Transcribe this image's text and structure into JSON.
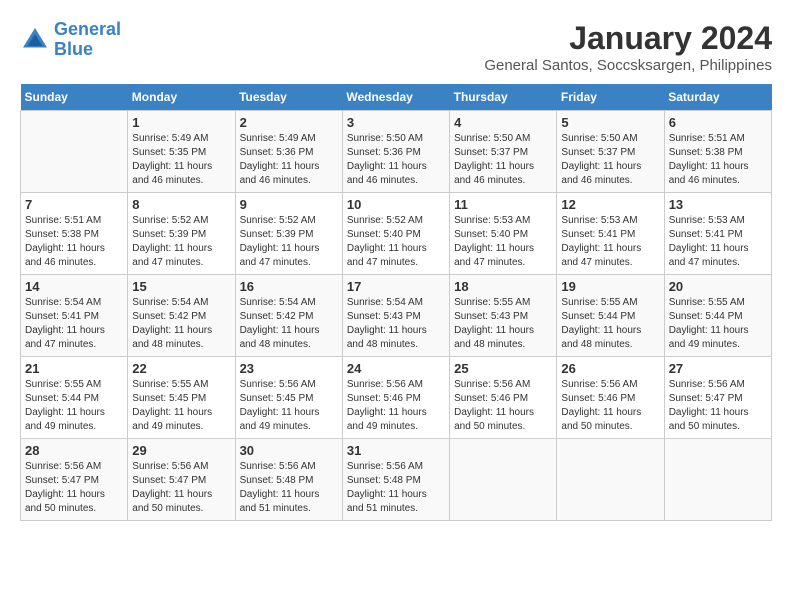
{
  "header": {
    "logo_line1": "General",
    "logo_line2": "Blue",
    "month_year": "January 2024",
    "location": "General Santos, Soccsksargen, Philippines"
  },
  "days_of_week": [
    "Sunday",
    "Monday",
    "Tuesday",
    "Wednesday",
    "Thursday",
    "Friday",
    "Saturday"
  ],
  "weeks": [
    [
      {
        "day": "",
        "info": ""
      },
      {
        "day": "1",
        "info": "Sunrise: 5:49 AM\nSunset: 5:35 PM\nDaylight: 11 hours and 46 minutes."
      },
      {
        "day": "2",
        "info": "Sunrise: 5:49 AM\nSunset: 5:36 PM\nDaylight: 11 hours and 46 minutes."
      },
      {
        "day": "3",
        "info": "Sunrise: 5:50 AM\nSunset: 5:36 PM\nDaylight: 11 hours and 46 minutes."
      },
      {
        "day": "4",
        "info": "Sunrise: 5:50 AM\nSunset: 5:37 PM\nDaylight: 11 hours and 46 minutes."
      },
      {
        "day": "5",
        "info": "Sunrise: 5:50 AM\nSunset: 5:37 PM\nDaylight: 11 hours and 46 minutes."
      },
      {
        "day": "6",
        "info": "Sunrise: 5:51 AM\nSunset: 5:38 PM\nDaylight: 11 hours and 46 minutes."
      }
    ],
    [
      {
        "day": "7",
        "info": "Sunrise: 5:51 AM\nSunset: 5:38 PM\nDaylight: 11 hours and 46 minutes."
      },
      {
        "day": "8",
        "info": "Sunrise: 5:52 AM\nSunset: 5:39 PM\nDaylight: 11 hours and 47 minutes."
      },
      {
        "day": "9",
        "info": "Sunrise: 5:52 AM\nSunset: 5:39 PM\nDaylight: 11 hours and 47 minutes."
      },
      {
        "day": "10",
        "info": "Sunrise: 5:52 AM\nSunset: 5:40 PM\nDaylight: 11 hours and 47 minutes."
      },
      {
        "day": "11",
        "info": "Sunrise: 5:53 AM\nSunset: 5:40 PM\nDaylight: 11 hours and 47 minutes."
      },
      {
        "day": "12",
        "info": "Sunrise: 5:53 AM\nSunset: 5:41 PM\nDaylight: 11 hours and 47 minutes."
      },
      {
        "day": "13",
        "info": "Sunrise: 5:53 AM\nSunset: 5:41 PM\nDaylight: 11 hours and 47 minutes."
      }
    ],
    [
      {
        "day": "14",
        "info": "Sunrise: 5:54 AM\nSunset: 5:41 PM\nDaylight: 11 hours and 47 minutes."
      },
      {
        "day": "15",
        "info": "Sunrise: 5:54 AM\nSunset: 5:42 PM\nDaylight: 11 hours and 48 minutes."
      },
      {
        "day": "16",
        "info": "Sunrise: 5:54 AM\nSunset: 5:42 PM\nDaylight: 11 hours and 48 minutes."
      },
      {
        "day": "17",
        "info": "Sunrise: 5:54 AM\nSunset: 5:43 PM\nDaylight: 11 hours and 48 minutes."
      },
      {
        "day": "18",
        "info": "Sunrise: 5:55 AM\nSunset: 5:43 PM\nDaylight: 11 hours and 48 minutes."
      },
      {
        "day": "19",
        "info": "Sunrise: 5:55 AM\nSunset: 5:44 PM\nDaylight: 11 hours and 48 minutes."
      },
      {
        "day": "20",
        "info": "Sunrise: 5:55 AM\nSunset: 5:44 PM\nDaylight: 11 hours and 49 minutes."
      }
    ],
    [
      {
        "day": "21",
        "info": "Sunrise: 5:55 AM\nSunset: 5:44 PM\nDaylight: 11 hours and 49 minutes."
      },
      {
        "day": "22",
        "info": "Sunrise: 5:55 AM\nSunset: 5:45 PM\nDaylight: 11 hours and 49 minutes."
      },
      {
        "day": "23",
        "info": "Sunrise: 5:56 AM\nSunset: 5:45 PM\nDaylight: 11 hours and 49 minutes."
      },
      {
        "day": "24",
        "info": "Sunrise: 5:56 AM\nSunset: 5:46 PM\nDaylight: 11 hours and 49 minutes."
      },
      {
        "day": "25",
        "info": "Sunrise: 5:56 AM\nSunset: 5:46 PM\nDaylight: 11 hours and 50 minutes."
      },
      {
        "day": "26",
        "info": "Sunrise: 5:56 AM\nSunset: 5:46 PM\nDaylight: 11 hours and 50 minutes."
      },
      {
        "day": "27",
        "info": "Sunrise: 5:56 AM\nSunset: 5:47 PM\nDaylight: 11 hours and 50 minutes."
      }
    ],
    [
      {
        "day": "28",
        "info": "Sunrise: 5:56 AM\nSunset: 5:47 PM\nDaylight: 11 hours and 50 minutes."
      },
      {
        "day": "29",
        "info": "Sunrise: 5:56 AM\nSunset: 5:47 PM\nDaylight: 11 hours and 50 minutes."
      },
      {
        "day": "30",
        "info": "Sunrise: 5:56 AM\nSunset: 5:48 PM\nDaylight: 11 hours and 51 minutes."
      },
      {
        "day": "31",
        "info": "Sunrise: 5:56 AM\nSunset: 5:48 PM\nDaylight: 11 hours and 51 minutes."
      },
      {
        "day": "",
        "info": ""
      },
      {
        "day": "",
        "info": ""
      },
      {
        "day": "",
        "info": ""
      }
    ]
  ]
}
